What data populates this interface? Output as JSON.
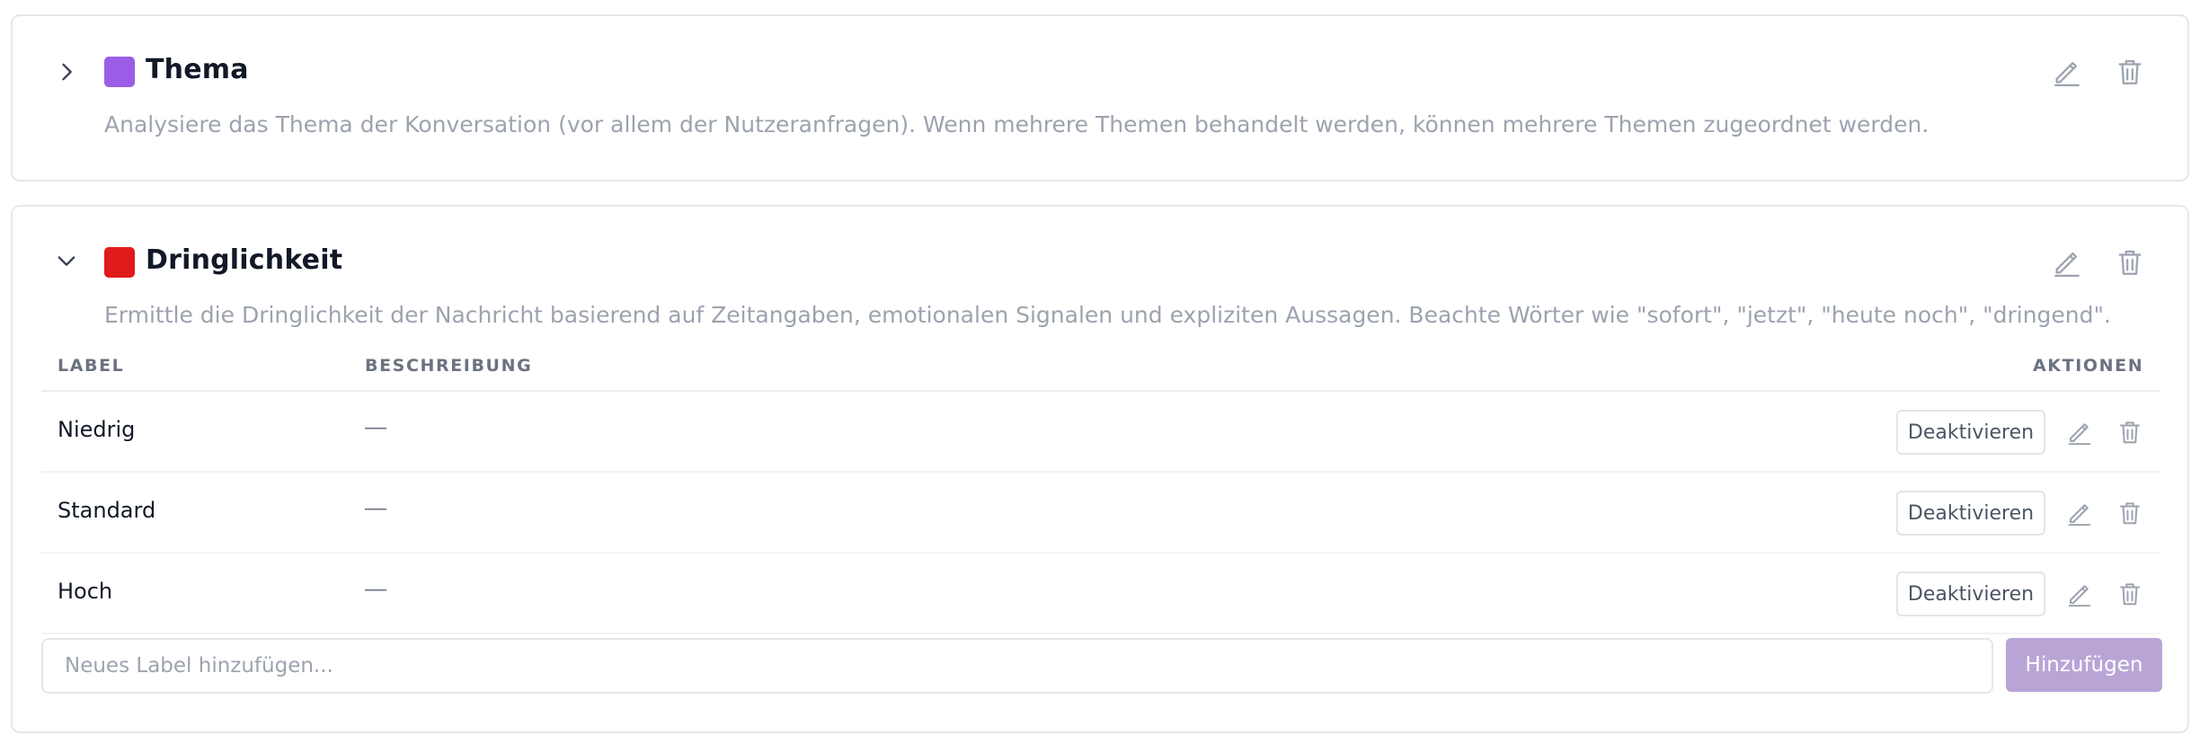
{
  "categories": [
    {
      "title": "Thema",
      "color": "#9b5de5",
      "expanded": false,
      "description": "Analysiere das Thema der Konversation (vor allem der Nutzeranfragen). Wenn mehrere Themen behandelt werden, können mehrere Themen zugeordnet werden."
    },
    {
      "title": "Dringlichkeit",
      "color": "#e01b1b",
      "expanded": true,
      "description": "Ermittle die Dringlichkeit der Nachricht basierend auf Zeitangaben, emotionalen Signalen und expliziten Aussagen. Beachte Wörter wie \"sofort\", \"jetzt\", \"heute noch\", \"dringend\".",
      "table": {
        "headers": {
          "label": "LABEL",
          "description": "BESCHREIBUNG",
          "actions": "AKTIONEN"
        },
        "rows": [
          {
            "label": "Niedrig",
            "description": "—",
            "action": "Deaktivieren"
          },
          {
            "label": "Standard",
            "description": "—",
            "action": "Deaktivieren"
          },
          {
            "label": "Hoch",
            "description": "—",
            "action": "Deaktivieren"
          }
        ]
      },
      "add_label": {
        "placeholder": "Neues Label hinzufügen...",
        "button": "Hinzufügen"
      }
    }
  ],
  "icons": {
    "collapsed": "chevron-right-icon",
    "expanded": "chevron-down-icon",
    "edit": "pencil-icon",
    "delete": "trash-icon"
  },
  "colors": {
    "accent_disabled": "#b8a5d6",
    "muted_text": "#9ca3af"
  }
}
